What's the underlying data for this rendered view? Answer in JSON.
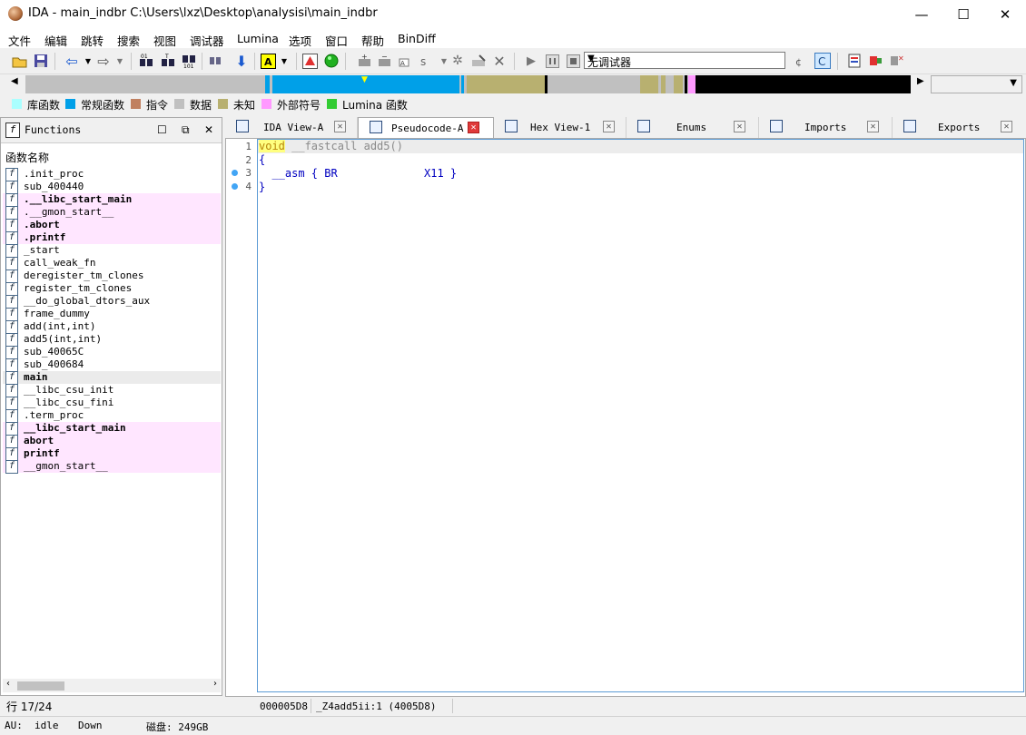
{
  "window": {
    "title": "IDA - main_indbr C:\\Users\\lxz\\Desktop\\analysisi\\main_indbr",
    "minimize": "—",
    "maximize": "☐",
    "close": "✕"
  },
  "menu": [
    "文件",
    "编辑",
    "跳转",
    "搜索",
    "视图",
    "调试器",
    "Lumina",
    "选项",
    "窗口",
    "帮助",
    "BinDiff"
  ],
  "toolbar": {
    "debugger_select": "无调试器"
  },
  "legend": [
    {
      "label": "库函数",
      "color": "#aaffff"
    },
    {
      "label": "常规函数",
      "color": "#00a0e8"
    },
    {
      "label": "指令",
      "color": "#c08060"
    },
    {
      "label": "数据",
      "color": "#c0c0c0"
    },
    {
      "label": "未知",
      "color": "#b8b070"
    },
    {
      "label": "外部符号",
      "color": "#ff99ff"
    },
    {
      "label": "Lumina 函数",
      "color": "#33cc33"
    }
  ],
  "functions_panel": {
    "title": "Functions",
    "column_header": "函数名称",
    "items": [
      {
        "name": ".init_proc",
        "style": ""
      },
      {
        "name": "sub_400440",
        "style": ""
      },
      {
        "name": ".__libc_start_main",
        "style": "hl b"
      },
      {
        "name": ".__gmon_start__",
        "style": "hl"
      },
      {
        "name": ".abort",
        "style": "hl b"
      },
      {
        "name": ".printf",
        "style": "hl b"
      },
      {
        "name": "_start",
        "style": ""
      },
      {
        "name": "call_weak_fn",
        "style": ""
      },
      {
        "name": "deregister_tm_clones",
        "style": ""
      },
      {
        "name": "register_tm_clones",
        "style": ""
      },
      {
        "name": "__do_global_dtors_aux",
        "style": ""
      },
      {
        "name": "frame_dummy",
        "style": ""
      },
      {
        "name": "add(int,int)",
        "style": ""
      },
      {
        "name": "add5(int,int)",
        "style": ""
      },
      {
        "name": "sub_40065C",
        "style": ""
      },
      {
        "name": "sub_400684",
        "style": ""
      },
      {
        "name": "main",
        "style": "sel b"
      },
      {
        "name": "__libc_csu_init",
        "style": ""
      },
      {
        "name": "__libc_csu_fini",
        "style": ""
      },
      {
        "name": ".term_proc",
        "style": ""
      },
      {
        "name": "__libc_start_main",
        "style": "hl b"
      },
      {
        "name": "abort",
        "style": "hl b"
      },
      {
        "name": "printf",
        "style": "hl b"
      },
      {
        "name": "__gmon_start__",
        "style": "hl"
      }
    ],
    "row_status": "行 17/24"
  },
  "tabs": [
    {
      "label": "IDA View-A",
      "active": false
    },
    {
      "label": "Pseudocode-A",
      "active": true
    },
    {
      "label": "Hex View-1",
      "active": false
    },
    {
      "label": "Enums",
      "active": false
    },
    {
      "label": "Imports",
      "active": false
    },
    {
      "label": "Exports",
      "active": false
    }
  ],
  "code": {
    "lines": [
      {
        "num": "1",
        "text": "void __fastcall add5()"
      },
      {
        "num": "2",
        "text": "{"
      },
      {
        "num": "3",
        "text": "  __asm { BR              X11 }"
      },
      {
        "num": "4",
        "text": "}"
      }
    ],
    "keyword": "void",
    "line1_rest": " __fastcall add5()",
    "line3_a": "  __asm { BR",
    "line3_b": "X11 }"
  },
  "editor_status": {
    "address": "000005D8",
    "location": "_Z4add5ii:1 (4005D8)"
  },
  "status_bar": {
    "au": "AU:",
    "au_state": "idle",
    "direction": "Down",
    "disk": "磁盘: 249GB"
  }
}
